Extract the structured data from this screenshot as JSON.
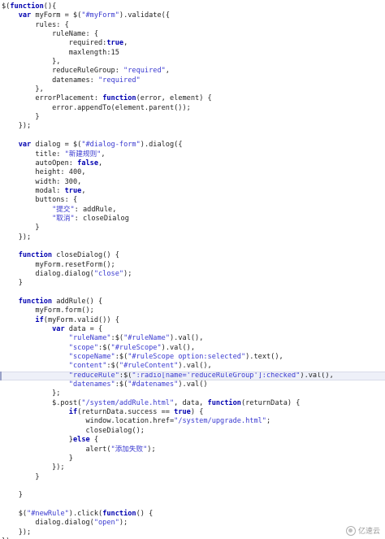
{
  "editor": {
    "highlighted_line": 40,
    "lines": [
      [
        [
          "$(",
          "pl"
        ],
        [
          "function",
          "kw"
        ],
        [
          "(){",
          "pl"
        ]
      ],
      [
        [
          "    ",
          "pl"
        ],
        [
          "var",
          "kw"
        ],
        [
          " myForm = $(",
          "pl"
        ],
        [
          "\"#myForm\"",
          "str"
        ],
        [
          ").validate({",
          "pl"
        ]
      ],
      [
        [
          "        rules: {",
          "pl"
        ]
      ],
      [
        [
          "            ruleName: {",
          "pl"
        ]
      ],
      [
        [
          "                required:",
          "pl"
        ],
        [
          "true",
          "kw"
        ],
        [
          ",",
          "pl"
        ]
      ],
      [
        [
          "                maxlength:15",
          "pl"
        ]
      ],
      [
        [
          "            },",
          "pl"
        ]
      ],
      [
        [
          "            reduceRuleGroup: ",
          "pl"
        ],
        [
          "\"required\"",
          "str"
        ],
        [
          ",",
          "pl"
        ]
      ],
      [
        [
          "            datenames: ",
          "pl"
        ],
        [
          "\"required\"",
          "str"
        ]
      ],
      [
        [
          "        },",
          "pl"
        ]
      ],
      [
        [
          "        errorPlacement: ",
          "pl"
        ],
        [
          "function",
          "kw"
        ],
        [
          "(error, element) {",
          "pl"
        ]
      ],
      [
        [
          "            error.appendTo(element.parent());",
          "pl"
        ]
      ],
      [
        [
          "        }",
          "pl"
        ]
      ],
      [
        [
          "    });",
          "pl"
        ]
      ],
      [
        [
          "",
          "pl"
        ]
      ],
      [
        [
          "    ",
          "pl"
        ],
        [
          "var",
          "kw"
        ],
        [
          " dialog = $(",
          "pl"
        ],
        [
          "\"#dialog-form\"",
          "str"
        ],
        [
          ").dialog({",
          "pl"
        ]
      ],
      [
        [
          "        title: ",
          "pl"
        ],
        [
          "\"新建规则\"",
          "str"
        ],
        [
          ",",
          "pl"
        ]
      ],
      [
        [
          "        autoOpen: ",
          "pl"
        ],
        [
          "false",
          "kw"
        ],
        [
          ",",
          "pl"
        ]
      ],
      [
        [
          "        height: 400,",
          "pl"
        ]
      ],
      [
        [
          "        width: 300,",
          "pl"
        ]
      ],
      [
        [
          "        modal: ",
          "pl"
        ],
        [
          "true",
          "kw"
        ],
        [
          ",",
          "pl"
        ]
      ],
      [
        [
          "        buttons: {",
          "pl"
        ]
      ],
      [
        [
          "            ",
          "pl"
        ],
        [
          "\"提交\"",
          "str"
        ],
        [
          ": addRule,",
          "pl"
        ]
      ],
      [
        [
          "            ",
          "pl"
        ],
        [
          "\"取消\"",
          "str"
        ],
        [
          ": closeDialog",
          "pl"
        ]
      ],
      [
        [
          "        }",
          "pl"
        ]
      ],
      [
        [
          "    });",
          "pl"
        ]
      ],
      [
        [
          "",
          "pl"
        ]
      ],
      [
        [
          "    ",
          "pl"
        ],
        [
          "function",
          "kw"
        ],
        [
          " closeDialog() {",
          "pl"
        ]
      ],
      [
        [
          "        myForm.resetForm();",
          "pl"
        ]
      ],
      [
        [
          "        dialog.dialog(",
          "pl"
        ],
        [
          "\"close\"",
          "str"
        ],
        [
          ");",
          "pl"
        ]
      ],
      [
        [
          "    }",
          "pl"
        ]
      ],
      [
        [
          "",
          "pl"
        ]
      ],
      [
        [
          "    ",
          "pl"
        ],
        [
          "function",
          "kw"
        ],
        [
          " addRule() {",
          "pl"
        ]
      ],
      [
        [
          "        myForm.form();",
          "pl"
        ]
      ],
      [
        [
          "        ",
          "pl"
        ],
        [
          "if",
          "kw"
        ],
        [
          "(myForm.valid()) {",
          "pl"
        ]
      ],
      [
        [
          "            ",
          "pl"
        ],
        [
          "var",
          "kw"
        ],
        [
          " data = {",
          "pl"
        ]
      ],
      [
        [
          "                ",
          "pl"
        ],
        [
          "\"ruleName\"",
          "str"
        ],
        [
          ":$(",
          "pl"
        ],
        [
          "\"#ruleName\"",
          "str"
        ],
        [
          ").val(),",
          "pl"
        ]
      ],
      [
        [
          "                ",
          "pl"
        ],
        [
          "\"scope\"",
          "str"
        ],
        [
          ":$(",
          "pl"
        ],
        [
          "\"#ruleScope\"",
          "str"
        ],
        [
          ").val(),",
          "pl"
        ]
      ],
      [
        [
          "                ",
          "pl"
        ],
        [
          "\"scopeName\"",
          "str"
        ],
        [
          ":$(",
          "pl"
        ],
        [
          "\"#ruleScope option:selected\"",
          "str"
        ],
        [
          ").text(),",
          "pl"
        ]
      ],
      [
        [
          "                ",
          "pl"
        ],
        [
          "\"content\"",
          "str"
        ],
        [
          ":$(",
          "pl"
        ],
        [
          "\"#ruleContent\"",
          "str"
        ],
        [
          ").val(),",
          "pl"
        ]
      ],
      [
        [
          "                ",
          "pl"
        ],
        [
          "\"reduceRule\"",
          "str"
        ],
        [
          ":$(",
          "pl"
        ],
        [
          "\":radio[name='reduceRuleGroup']:checked\"",
          "str"
        ],
        [
          ").val(),",
          "pl"
        ]
      ],
      [
        [
          "                ",
          "pl"
        ],
        [
          "\"datenames\"",
          "str"
        ],
        [
          ":$(",
          "pl"
        ],
        [
          "\"#datenames\"",
          "str"
        ],
        [
          ").val()",
          "pl"
        ]
      ],
      [
        [
          "            };",
          "pl"
        ]
      ],
      [
        [
          "            $.post(",
          "pl"
        ],
        [
          "\"/system/addRule.html\"",
          "str"
        ],
        [
          ", data, ",
          "pl"
        ],
        [
          "function",
          "kw"
        ],
        [
          "(returnData) {",
          "pl"
        ]
      ],
      [
        [
          "                ",
          "pl"
        ],
        [
          "if",
          "kw"
        ],
        [
          "(returnData.success == ",
          "pl"
        ],
        [
          "true",
          "kw"
        ],
        [
          ") {",
          "pl"
        ]
      ],
      [
        [
          "                    window.location.href=",
          "pl"
        ],
        [
          "\"/system/upgrade.html\"",
          "str"
        ],
        [
          ";",
          "pl"
        ]
      ],
      [
        [
          "                    closeDialog();",
          "pl"
        ]
      ],
      [
        [
          "                }",
          "pl"
        ],
        [
          "else",
          "kw"
        ],
        [
          " {",
          "pl"
        ]
      ],
      [
        [
          "                    alert(",
          "pl"
        ],
        [
          "\"添加失败\"",
          "str"
        ],
        [
          ");",
          "pl"
        ]
      ],
      [
        [
          "                }",
          "pl"
        ]
      ],
      [
        [
          "            });",
          "pl"
        ]
      ],
      [
        [
          "        }",
          "pl"
        ]
      ],
      [
        [
          "",
          "pl"
        ]
      ],
      [
        [
          "    }",
          "pl"
        ]
      ],
      [
        [
          "",
          "pl"
        ]
      ],
      [
        [
          "    $(",
          "pl"
        ],
        [
          "\"#newRule\"",
          "str"
        ],
        [
          ").click(",
          "pl"
        ],
        [
          "function",
          "kw"
        ],
        [
          "() {",
          "pl"
        ]
      ],
      [
        [
          "        dialog.dialog(",
          "pl"
        ],
        [
          "\"open\"",
          "str"
        ],
        [
          ");",
          "pl"
        ]
      ],
      [
        [
          "    });",
          "pl"
        ]
      ],
      [
        [
          "});",
          "pl"
        ]
      ]
    ]
  },
  "watermark": {
    "text": "亿速云",
    "icon": "cloud-logo-icon"
  }
}
